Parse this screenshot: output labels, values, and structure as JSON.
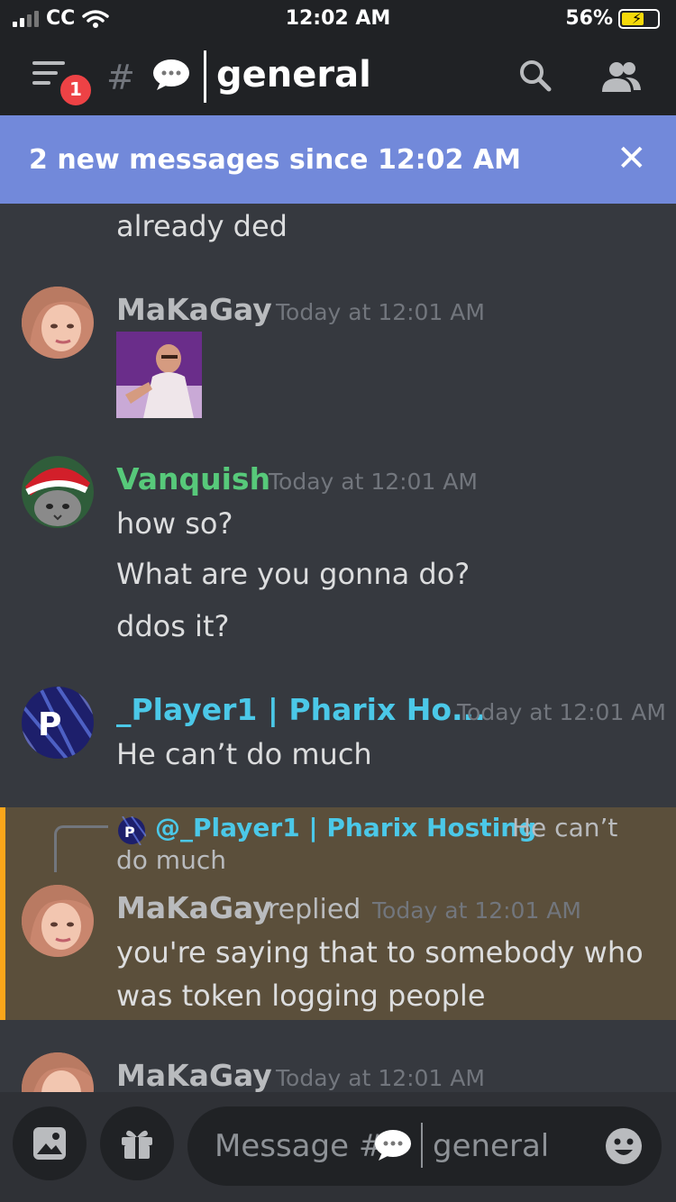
{
  "status_bar": {
    "carrier": "CC",
    "time": "12:02 AM",
    "battery": "56%",
    "battery_level": 0.56
  },
  "header": {
    "menu_badge": "1",
    "channel_name": "general",
    "icons": [
      "menu-icon",
      "locked-hash-icon",
      "speech-bubble-emoji",
      "search-icon",
      "members-icon"
    ]
  },
  "banner": {
    "text": "2 new messages since 12:02 AM",
    "close_icon": "close-icon"
  },
  "messages": {
    "continued": {
      "text": "already ded"
    },
    "m1": {
      "author": "MaKaGay",
      "time": "Today at 12:01 AM",
      "attachment": "image"
    },
    "m2": {
      "author": "Vanquish",
      "time": "Today at 12:01 AM",
      "lines": [
        "how so?",
        "What are you gonna do?",
        "ddos it?"
      ]
    },
    "m3": {
      "author": "_Player1 | Pharix Ho...",
      "time": "Today at 12:01 AM",
      "text": "He can’t do much"
    },
    "m4": {
      "reply_to_author": "@_Player1 | Pharix Hosting",
      "reply_preview_1": "He can’t",
      "reply_preview_2": "do much",
      "author": "MaKaGay",
      "replied_label": "replied",
      "time": "Today at 12:01 AM",
      "lines": [
        "you're saying that to somebody who",
        "was token logging people"
      ]
    },
    "m5": {
      "author": "MaKaGay",
      "time": "Today at 12:01 AM"
    }
  },
  "composer": {
    "placeholder_prefix": "Message #",
    "placeholder_channel": "general",
    "icons": [
      "image-icon",
      "gift-icon",
      "emoji-icon"
    ]
  },
  "colors": {
    "header_bg": "#202225",
    "banner_bg": "#7289da",
    "chat_bg": "#36393f",
    "vanquish_name": "#57c97a",
    "player1_name": "#4bc8e8",
    "default_name": "#b9bbbe",
    "reply_highlight": "#5b4f3b",
    "reply_accent": "#faa61a"
  }
}
